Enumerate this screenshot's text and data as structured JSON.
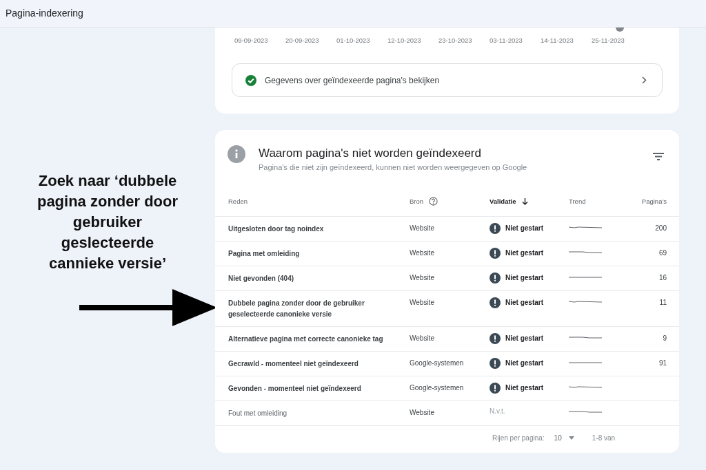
{
  "header": {
    "title": "Pagina-indexering"
  },
  "annotation": {
    "text": "Zoek naar ‘dubbele pagina zonder door gebruiker geslecteerde cannieke versie’"
  },
  "indexed_card": {
    "axis_dates": [
      "09-09-2023",
      "20-09-2023",
      "01-10-2023",
      "12-10-2023",
      "23-10-2023",
      "03-11-2023",
      "14-11-2023",
      "25-11-2023"
    ],
    "link": "Gegevens over geïndexeerde pagina's bekijken"
  },
  "reasons_card": {
    "title": "Waarom pagina's niet worden geïndexeerd",
    "subtitle": "Pagina's die niet zijn geïndexeerd, kunnen niet worden weergegeven op Google",
    "columns": [
      {
        "label": "Reden",
        "kind": "plain"
      },
      {
        "label": "Bron",
        "kind": "help"
      },
      {
        "label": "Validatie",
        "kind": "sorted"
      },
      {
        "label": "Trend",
        "kind": "plain"
      },
      {
        "label": "Pagina's",
        "kind": "number"
      }
    ],
    "rows": [
      {
        "reason": "Uitgesloten door tag noindex",
        "source": "Website",
        "status": "Niet gestart",
        "kind": "warning",
        "pages": "200"
      },
      {
        "reason": "Pagina met omleiding",
        "source": "Website",
        "status": "Niet gestart",
        "kind": "warning",
        "pages": "69"
      },
      {
        "reason": "Niet gevonden (404)",
        "source": "Website",
        "status": "Niet gestart",
        "kind": "warning",
        "pages": "16"
      },
      {
        "reason": "Dubbele pagina zonder door de gebruiker geselecteerde canonieke versie",
        "source": "Website",
        "status": "Niet gestart",
        "kind": "warning",
        "pages": "11"
      },
      {
        "reason": "Alternatieve pagina met correcte canonieke tag",
        "source": "Website",
        "status": "Niet gestart",
        "kind": "warning",
        "pages": "9"
      },
      {
        "reason": "Gecrawld - momenteel niet geïndexeerd",
        "source": "Google-systemen",
        "status": "Niet gestart",
        "kind": "warning",
        "pages": "91"
      },
      {
        "reason": "Gevonden - momenteel niet geïndexeerd",
        "source": "Google-systemen",
        "status": "Niet gestart",
        "kind": "warning"
      },
      {
        "reason": "Fout met omleiding",
        "source": "Website",
        "status": "N.v.t.",
        "kind": "none"
      }
    ],
    "pagination": {
      "rows_label": "Rijen per pagina:",
      "rows_value": "10",
      "range": "1-8 van"
    }
  }
}
